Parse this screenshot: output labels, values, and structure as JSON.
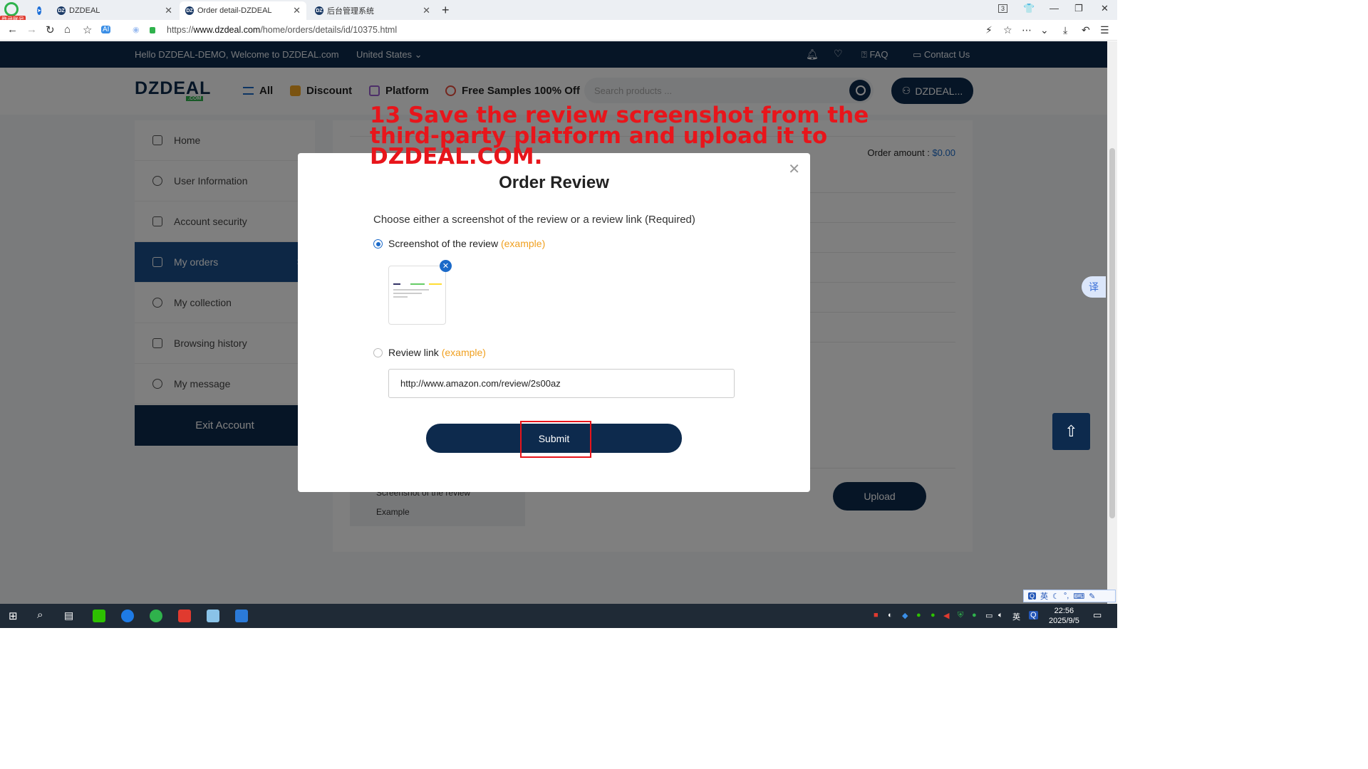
{
  "browser": {
    "badge_label": "登录账号",
    "tabs": [
      {
        "label": "DZDEAL"
      },
      {
        "label": "Order detail-DZDEAL"
      },
      {
        "label": "后台管理系统"
      }
    ],
    "url_prefix": "https://",
    "url_domain": "www.dzdeal.com",
    "url_path": "/home/orders/details/id/10375.html",
    "tab_count_badge": "3"
  },
  "site": {
    "welcome": "Hello DZDEAL-DEMO, Welcome to DZDEAL.com",
    "country": "United States",
    "faq": "FAQ",
    "contact": "Contact Us",
    "logo": "DZDEAL",
    "logo_sub": ".COM",
    "nav": {
      "all": "All",
      "discount": "Discount",
      "platform": "Platform",
      "free_samples": "Free Samples 100% Off"
    },
    "search_placeholder": "Search products ...",
    "user_button": "DZDEAL..."
  },
  "sidebar": {
    "items": [
      {
        "label": "Home"
      },
      {
        "label": "User Information"
      },
      {
        "label": "Account security"
      },
      {
        "label": "My orders"
      },
      {
        "label": "My collection"
      },
      {
        "label": "Browsing history"
      },
      {
        "label": "My message"
      }
    ],
    "exit": "Exit Account"
  },
  "content": {
    "order_amount_label": "Order amount :",
    "order_amount_value": "$0.00",
    "lower_label_1": "Screenshot of the review",
    "lower_label_2": "Example",
    "upload": "Upload"
  },
  "annotation": "13 Save the review screenshot from the third-party platform and upload it to DZDEAL.COM.",
  "modal": {
    "title": "Order Review",
    "instruction": "Choose either a screenshot of the review or a review link (Required)",
    "option_screenshot": "Screenshot of the review",
    "option_link": "Review link",
    "example": "(example)",
    "link_value": "http://www.amazon.com/review/2s00az",
    "submit": "Submit"
  },
  "ime": {
    "lang": "英"
  },
  "taskbar": {
    "time": "22:56",
    "date": "2025/9/5",
    "lang": "英"
  },
  "translate": "译"
}
